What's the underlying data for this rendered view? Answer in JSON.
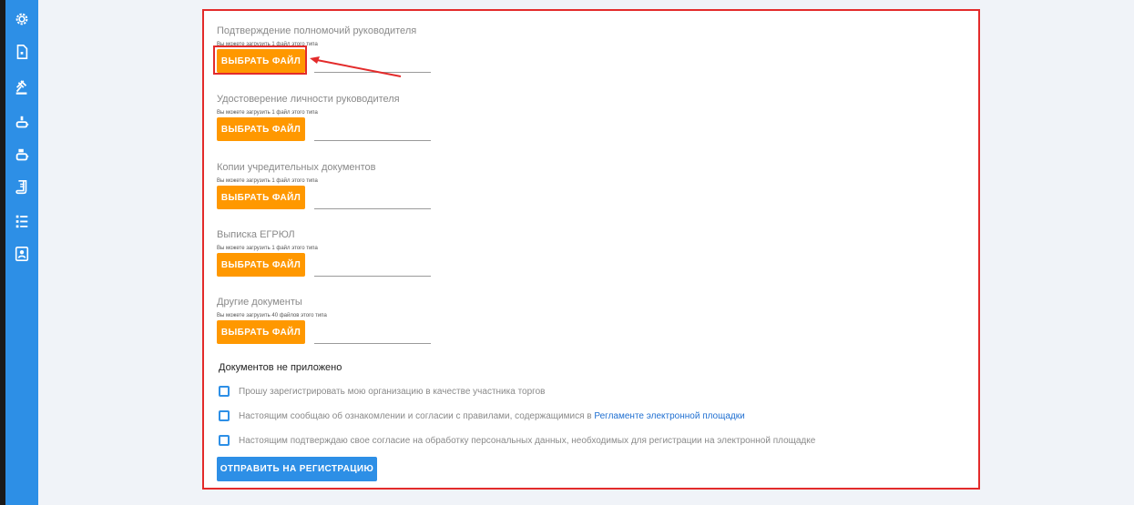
{
  "sidebar": {
    "icons": [
      "gear-icon",
      "file-icon",
      "gavel-icon",
      "pawn-icon",
      "tag-icon",
      "scroll-icon",
      "list-icon",
      "contacts-icon"
    ]
  },
  "documents": [
    {
      "title": "Подтверждение полномочий руководителя",
      "hint": "Вы можете загрузить 1 файл этого типа",
      "button": "ВЫБРАТЬ ФАЙЛ"
    },
    {
      "title": "Удостоверение личности руководителя",
      "hint": "Вы можете загрузить 1 файл этого типа",
      "button": "ВЫБРАТЬ ФАЙЛ"
    },
    {
      "title": "Копии учредительных документов",
      "hint": "Вы можете загрузить 1 файл этого типа",
      "button": "ВЫБРАТЬ ФАЙЛ"
    },
    {
      "title": "Выписка ЕГРЮЛ",
      "hint": "Вы можете загрузить 1 файл этого типа",
      "button": "ВЫБРАТЬ ФАЙЛ"
    },
    {
      "title": "Другие документы",
      "hint": "Вы можете загрузить 40 файлов этого типа",
      "button": "ВЫБРАТЬ ФАЙЛ"
    }
  ],
  "docs_status": "Документов не приложено",
  "checks": [
    {
      "text": "Прошу зарегистрировать мою организацию в качестве участника торгов"
    },
    {
      "text": "Настоящим сообщаю об ознакомлении и согласии с правилами, содержащимися в ",
      "link": "Регламенте электронной площадки"
    },
    {
      "text": "Настоящим подтверждаю свое согласие на обработку персональных данных, необходимых для регистрации на электронной площадке"
    }
  ],
  "submit_label": "ОТПРАВИТЬ НА РЕГИСТРАЦИЮ",
  "colors": {
    "accent": "#2d8fe6",
    "file_button": "#ff9800",
    "annotation": "#e32b2b"
  }
}
